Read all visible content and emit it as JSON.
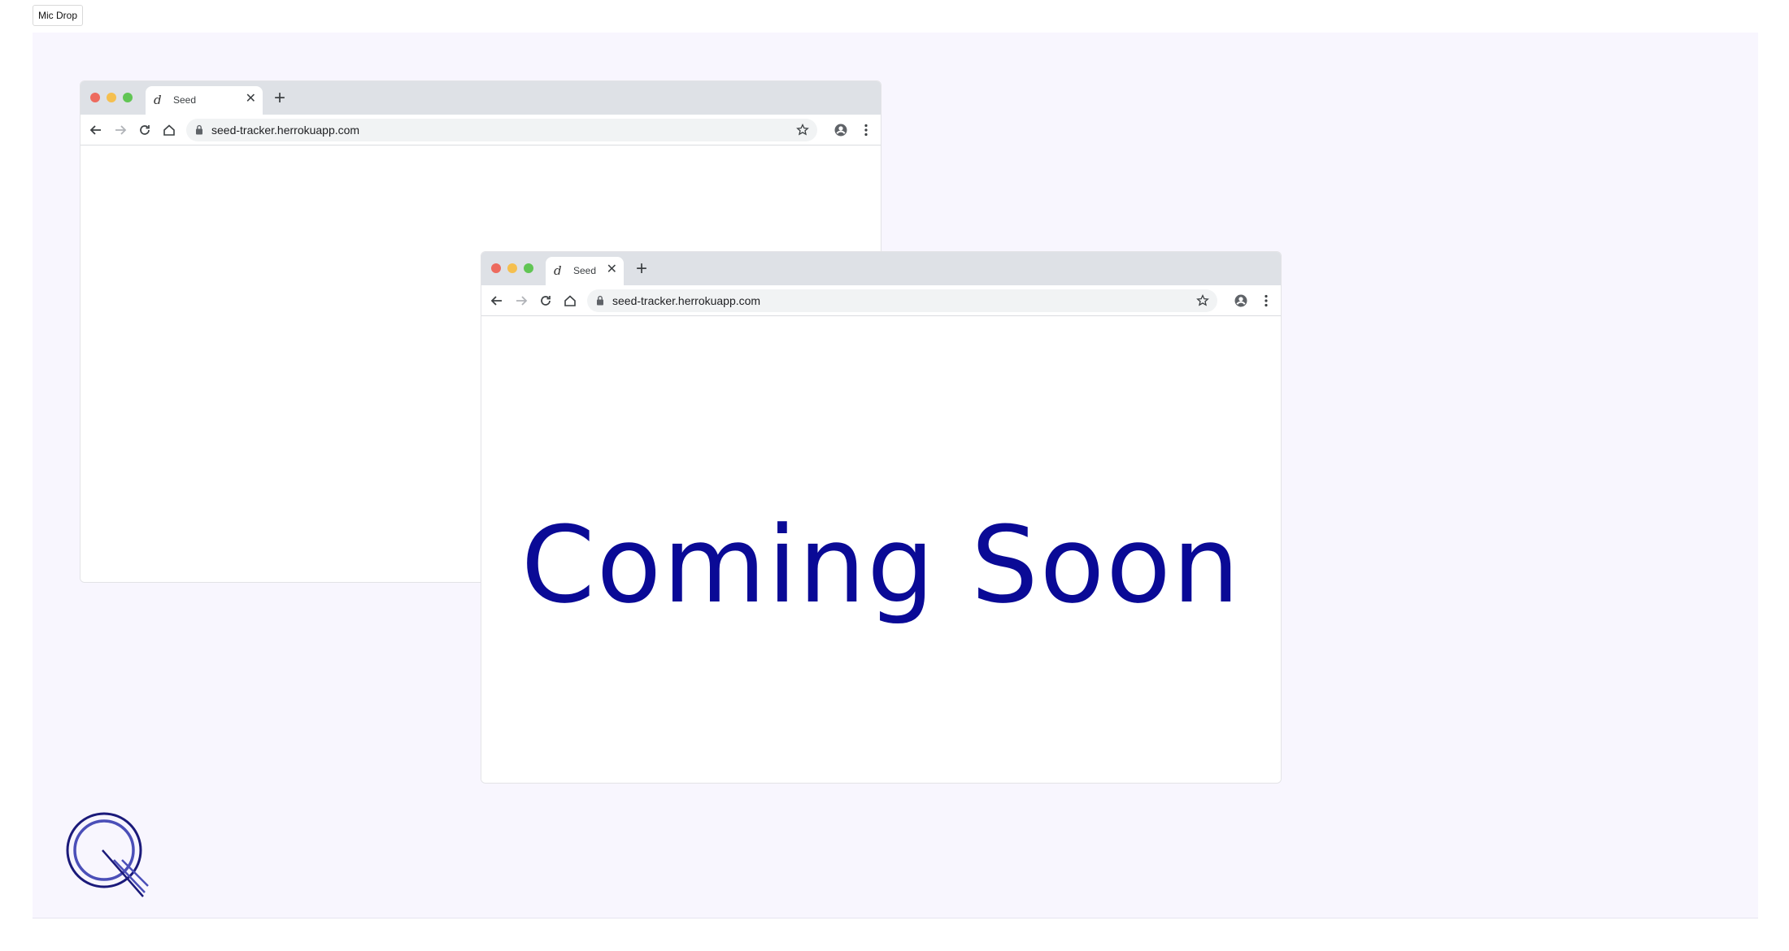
{
  "top_button": {
    "label": "Mic Drop"
  },
  "browser_back": {
    "tab": {
      "title": "Seed",
      "icon": "seed-favicon",
      "close_glyph": "✕",
      "new_tab_glyph": "+"
    },
    "address": {
      "url": "seed-tracker.herrokuapp.com"
    }
  },
  "browser_front": {
    "tab": {
      "title": "Seed",
      "icon": "seed-favicon",
      "close_glyph": "✕",
      "new_tab_glyph": "+"
    },
    "address": {
      "url": "seed-tracker.herrokuapp.com"
    },
    "content": {
      "headline": "Coming Soon"
    }
  },
  "colors": {
    "canvas_bg": "#f8f6fe",
    "headline": "#0a0a96",
    "logo": "#1b1a7a",
    "traffic_red": "#ed6a5e",
    "traffic_yellow": "#f5bf4f",
    "traffic_green": "#61c554"
  },
  "logo": {
    "icon": "q-brand-logo"
  }
}
